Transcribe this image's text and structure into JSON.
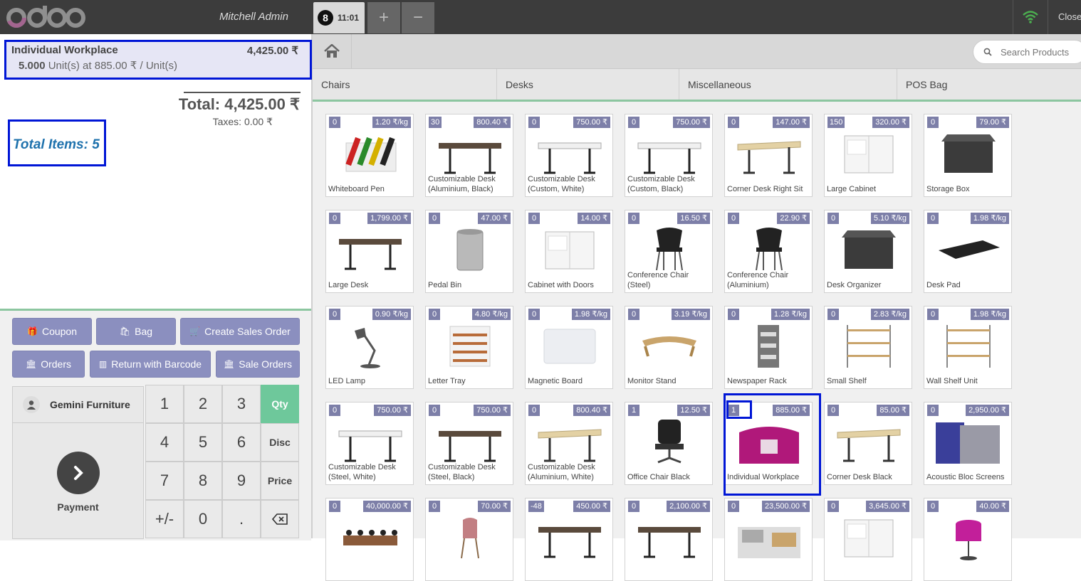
{
  "header": {
    "logo_text": "odoo",
    "user": "Mitchell Admin",
    "session_number": "8",
    "session_time": "11:01",
    "add_label": "+",
    "remove_label": "−",
    "close_label": "Close"
  },
  "order": {
    "line": {
      "name": "Individual Workplace",
      "price": "4,425.00 ₹",
      "qty": "5.000",
      "unit_info": "Unit(s) at 885.00 ₹ / Unit(s)"
    },
    "total": "Total: 4,425.00 ₹",
    "taxes": "Taxes: 0.00 ₹",
    "total_items": "Total Items: 5"
  },
  "control_buttons": {
    "coupon": "Coupon",
    "bag": "Bag",
    "create_sales_order": "Create Sales Order",
    "orders": "Orders",
    "return_barcode": "Return with Barcode",
    "sale_orders": "Sale Orders"
  },
  "customer": "Gemini Furniture",
  "payment": "Payment",
  "numpad": {
    "keys": [
      "1",
      "2",
      "3",
      "4",
      "5",
      "6",
      "7",
      "8",
      "9",
      "+/-",
      "0",
      "."
    ],
    "modes": [
      "Qty",
      "Disc",
      "Price"
    ],
    "active_mode": "Qty"
  },
  "search": {
    "placeholder": "Search Products"
  },
  "categories": [
    "Chairs",
    "Desks",
    "Miscellaneous",
    "POS Bag"
  ],
  "products": [
    {
      "name": "Whiteboard Pen",
      "qty": "0",
      "price": "1.20 ₹/kg",
      "icon": "pens"
    },
    {
      "name": "Customizable Desk (Aluminium, Black)",
      "qty": "30",
      "price": "800.40 ₹",
      "icon": "desk-dark"
    },
    {
      "name": "Customizable Desk (Custom, White)",
      "qty": "0",
      "price": "750.00 ₹",
      "icon": "desk-white"
    },
    {
      "name": "Customizable Desk (Custom, Black)",
      "qty": "0",
      "price": "750.00 ₹",
      "icon": "desk-white"
    },
    {
      "name": "Corner Desk Right Sit",
      "qty": "0",
      "price": "147.00 ₹",
      "icon": "desk-wood"
    },
    {
      "name": "Large Cabinet",
      "qty": "150",
      "price": "320.00 ₹",
      "icon": "cabinet"
    },
    {
      "name": "Storage Box",
      "qty": "0",
      "price": "79.00 ₹",
      "icon": "box"
    },
    {
      "name": "Large Desk",
      "qty": "0",
      "price": "1,799.00 ₹",
      "icon": "desk-dark"
    },
    {
      "name": "Pedal Bin",
      "qty": "0",
      "price": "47.00 ₹",
      "icon": "bin"
    },
    {
      "name": "Cabinet with Doors",
      "qty": "0",
      "price": "14.00 ₹",
      "icon": "cabinet"
    },
    {
      "name": "Conference Chair (Steel)",
      "qty": "0",
      "price": "16.50 ₹",
      "icon": "chair"
    },
    {
      "name": "Conference Chair (Aluminium)",
      "qty": "0",
      "price": "22.90 ₹",
      "icon": "chair"
    },
    {
      "name": "Desk Organizer",
      "qty": "0",
      "price": "5.10 ₹/kg",
      "icon": "box"
    },
    {
      "name": "Desk Pad",
      "qty": "0",
      "price": "1.98 ₹/kg",
      "icon": "pad"
    },
    {
      "name": "LED Lamp",
      "qty": "0",
      "price": "0.90 ₹/kg",
      "icon": "lamp"
    },
    {
      "name": "Letter Tray",
      "qty": "0",
      "price": "4.80 ₹/kg",
      "icon": "tray"
    },
    {
      "name": "Magnetic Board",
      "qty": "0",
      "price": "1.98 ₹/kg",
      "icon": "board"
    },
    {
      "name": "Monitor Stand",
      "qty": "0",
      "price": "3.19 ₹/kg",
      "icon": "stand"
    },
    {
      "name": "Newspaper Rack",
      "qty": "0",
      "price": "1.28 ₹/kg",
      "icon": "rack"
    },
    {
      "name": "Small Shelf",
      "qty": "0",
      "price": "2.83 ₹/kg",
      "icon": "shelf"
    },
    {
      "name": "Wall Shelf Unit",
      "qty": "0",
      "price": "1.98 ₹/kg",
      "icon": "shelf"
    },
    {
      "name": "Customizable Desk (Steel, White)",
      "qty": "0",
      "price": "750.00 ₹",
      "icon": "desk-white"
    },
    {
      "name": "Customizable Desk (Steel, Black)",
      "qty": "0",
      "price": "750.00 ₹",
      "icon": "desk-dark"
    },
    {
      "name": "Customizable Desk (Aluminium, White)",
      "qty": "0",
      "price": "800.40 ₹",
      "icon": "desk-wood"
    },
    {
      "name": "Office Chair Black",
      "qty": "1",
      "price": "12.50 ₹",
      "icon": "office-chair"
    },
    {
      "name": "Individual Workplace",
      "qty": "1",
      "price": "885.00 ₹",
      "icon": "workplace"
    },
    {
      "name": "Corner Desk Black",
      "qty": "0",
      "price": "85.00 ₹",
      "icon": "desk-wood"
    },
    {
      "name": "Acoustic Bloc Screens",
      "qty": "0",
      "price": "2,950.00 ₹",
      "icon": "screens"
    },
    {
      "name": "",
      "qty": "0",
      "price": "40,000.00 ₹",
      "icon": "conf-table"
    },
    {
      "name": "",
      "qty": "0",
      "price": "70.00 ₹",
      "icon": "pink-chair"
    },
    {
      "name": "",
      "qty": "-48",
      "price": "450.00 ₹",
      "icon": "desk-dark"
    },
    {
      "name": "",
      "qty": "0",
      "price": "2,100.00 ₹",
      "icon": "desk-dark"
    },
    {
      "name": "",
      "qty": "0",
      "price": "23,500.00 ₹",
      "icon": "office"
    },
    {
      "name": "",
      "qty": "0",
      "price": "3,645.00 ₹",
      "icon": "cabinet"
    },
    {
      "name": "",
      "qty": "0",
      "price": "40.00 ₹",
      "icon": "pink-lamp"
    }
  ]
}
